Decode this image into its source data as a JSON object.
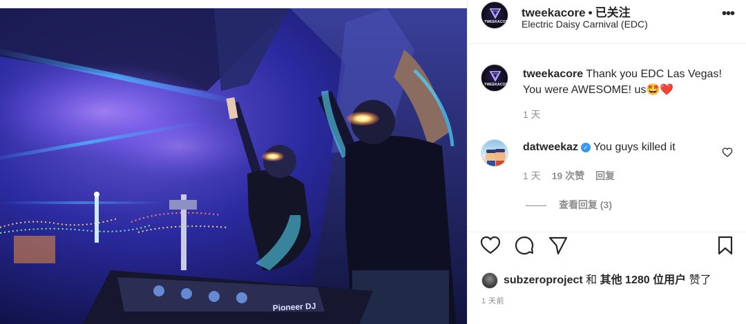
{
  "post": {
    "username": "tweekacore",
    "follow_status": "已关注",
    "location": "Electric Daisy Carnival (EDC)",
    "more_icon": "more-horizontal-icon",
    "avatar_logo_text": "TWEEKACORE"
  },
  "photo": {
    "mixer_brand": "Pioneer DJ"
  },
  "comments": [
    {
      "username": "tweekacore",
      "text": "Thank you EDC Las Vegas! You were AWESOME! us",
      "emojis": "🤩❤️",
      "time": "1 天"
    },
    {
      "username": "datweekaz",
      "verified": true,
      "text": "You guys killed it",
      "time": "1 天",
      "likes": "19 次赞",
      "reply_label": "回复",
      "view_replies": "查看回复 (3)"
    }
  ],
  "actions": {
    "like_icon": "heart-icon",
    "comment_icon": "comment-icon",
    "share_icon": "share-icon",
    "save_icon": "bookmark-icon"
  },
  "likes": {
    "first_user": "subzeroproject",
    "connector": "和",
    "others": "其他 1280 位用户",
    "suffix": "赞了"
  },
  "timestamp": "1 天前",
  "colors": {
    "verified": "#3897f0",
    "secondary_text": "#8e8e8e",
    "primary_text": "#262626"
  }
}
